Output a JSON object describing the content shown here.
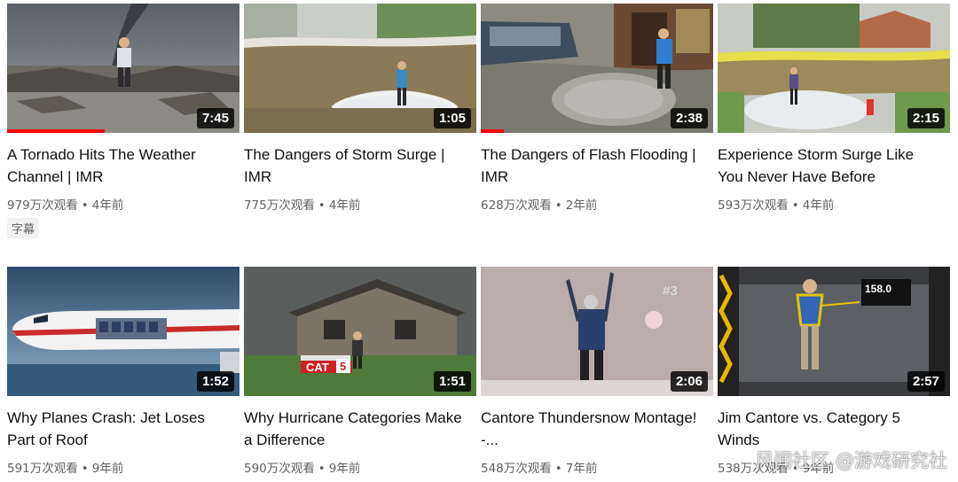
{
  "videos": [
    {
      "title": "A Tornado Hits The Weather Channel | IMR",
      "views": "979万次观看",
      "age": "4年前",
      "duration": "7:45",
      "watched_fraction": 0.42,
      "badge": "字幕",
      "thumbnail_icon": "tornado-thumbnail"
    },
    {
      "title": "The Dangers of Storm Surge | IMR",
      "views": "775万次观看",
      "age": "4年前",
      "duration": "1:05",
      "thumbnail_icon": "storm-surge-thumbnail"
    },
    {
      "title": "The Dangers of Flash Flooding | IMR",
      "views": "628万次观看",
      "age": "2年前",
      "duration": "2:38",
      "watched_fraction": 0.1,
      "thumbnail_icon": "flash-flood-thumbnail"
    },
    {
      "title": "Experience Storm Surge Like You Never Have Before",
      "views": "593万次观看",
      "age": "4年前",
      "duration": "2:15",
      "thumbnail_icon": "storm-surge-house-thumbnail"
    },
    {
      "title": "Why Planes Crash: Jet Loses Part of Roof",
      "views": "591万次观看",
      "age": "9年前",
      "duration": "1:52",
      "thumbnail_icon": "plane-thumbnail"
    },
    {
      "title": "Why Hurricane Categories Make a Difference",
      "views": "590万次观看",
      "age": "9年前",
      "duration": "1:51",
      "thumbnail_icon": "hurricane-house-thumbnail"
    },
    {
      "title": "Cantore Thundersnow Montage! -...",
      "views": "548万次观看",
      "age": "7年前",
      "duration": "2:06",
      "thumbnail_icon": "thundersnow-thumbnail"
    },
    {
      "title": "Jim Cantore vs. Category 5 Winds",
      "views": "538万次观看",
      "age": "9年前",
      "duration": "2:57",
      "thumbnail_icon": "wind-tunnel-thumbnail"
    }
  ],
  "thumb_text": {
    "cat_label": "CAT",
    "cat_number": "5",
    "hash_number": "#3",
    "gauge_reading": "158.0"
  },
  "meta_separator": "•",
  "watermark": "风闻社区 @游戏研究社"
}
